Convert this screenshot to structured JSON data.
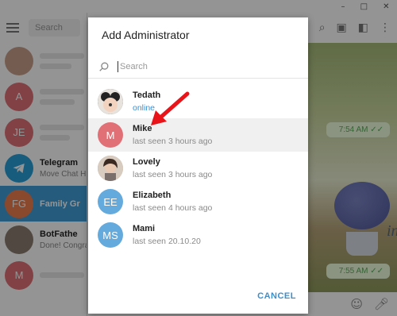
{
  "background": {
    "search_placeholder": "Search",
    "chats": [
      {
        "initials": "",
        "color": "#c9a08a",
        "name": "",
        "sub": ""
      },
      {
        "initials": "A",
        "color": "#e17076",
        "name": "",
        "sub": ""
      },
      {
        "initials": "JE",
        "color": "#e17076",
        "name": "",
        "sub": ""
      },
      {
        "initials": "",
        "color": "#2a9fd8",
        "name": "Telegram",
        "sub": "Move Chat H"
      },
      {
        "initials": "FG",
        "color": "#ee7d4f",
        "name": "Family Gr",
        "sub": ""
      },
      {
        "initials": "",
        "color": "#8a7d70",
        "name": "BotFathe",
        "sub": "Done! Congra"
      },
      {
        "initials": "M",
        "color": "#e17076",
        "name": "",
        "sub": ""
      }
    ],
    "bubbles": [
      {
        "time": "7:54 AM ✓✓"
      },
      {
        "time": "7:55 AM ✓✓"
      }
    ],
    "wall_text": "ing",
    "window_controls": [
      "–",
      "□",
      "✕"
    ]
  },
  "dialog": {
    "title": "Add Administrator",
    "search_placeholder": "Search",
    "users": [
      {
        "name": "Tedath",
        "status": "online",
        "online": true,
        "initials": "",
        "color": "#2f3440"
      },
      {
        "name": "Mike",
        "status": "last seen 3 hours ago",
        "online": false,
        "initials": "M",
        "color": "#e17076"
      },
      {
        "name": "Lovely",
        "status": "last seen 3 hours ago",
        "online": false,
        "initials": "",
        "color": "#b79a84"
      },
      {
        "name": "Elizabeth",
        "status": "last seen 4 hours ago",
        "online": false,
        "initials": "EE",
        "color": "#65aadd"
      },
      {
        "name": "Mami",
        "status": "last seen 20.10.20",
        "online": false,
        "initials": "MS",
        "color": "#65aadd"
      }
    ],
    "cancel_label": "CANCEL"
  },
  "annotation": {
    "arrow_color": "#e8141a"
  }
}
